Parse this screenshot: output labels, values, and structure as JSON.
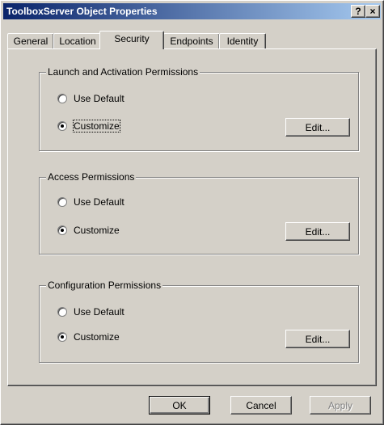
{
  "window": {
    "title": "ToolboxServer Object Properties",
    "help_button": "?",
    "close_button": "×"
  },
  "tabs": [
    {
      "label": "General",
      "active": false
    },
    {
      "label": "Location",
      "active": false
    },
    {
      "label": "Security",
      "active": true
    },
    {
      "label": "Endpoints",
      "active": false
    },
    {
      "label": "Identity",
      "active": false
    }
  ],
  "groups": {
    "launch": {
      "title": "Launch and Activation Permissions",
      "use_default_label": "Use Default",
      "customize_label": "Customize",
      "edit_label": "Edit...",
      "selected": "customize"
    },
    "access": {
      "title": "Access Permissions",
      "use_default_label": "Use Default",
      "customize_label": "Customize",
      "edit_label": "Edit...",
      "selected": "customize"
    },
    "configuration": {
      "title": "Configuration Permissions",
      "use_default_label": "Use Default",
      "customize_label": "Customize",
      "edit_label": "Edit...",
      "selected": "customize"
    }
  },
  "footer": {
    "ok_label": "OK",
    "cancel_label": "Cancel",
    "apply_label": "Apply"
  }
}
